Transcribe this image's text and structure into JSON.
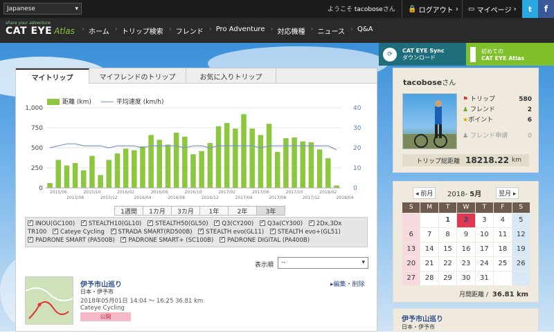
{
  "topbar": {
    "language": "Japanese",
    "welcome_prefix": "ようこそ",
    "username": "tacobose",
    "welcome_suffix": "さん",
    "logout": "ログアウト",
    "mypage": "マイページ",
    "twitter": "t",
    "facebook": "f"
  },
  "nav": {
    "tagline": "share your adventure",
    "brand": "CAT EYE",
    "brand_accent": "Atlas",
    "items": [
      "ホーム",
      "トリップ検索",
      "フレンド",
      "Pro Adventure",
      "対応機種",
      "ニュース",
      "Q&A"
    ]
  },
  "banners": {
    "sync_line1": "CAT EYE Sync",
    "sync_line2": "ダウンロード",
    "first_line1": "初めての",
    "first_line2": "CAT EYE Atlas"
  },
  "tabs": [
    "マイトリップ",
    "マイフレンドのトリップ",
    "お気に入りトリップ"
  ],
  "chart_data": {
    "type": "bar",
    "legend": [
      "距離 (km)",
      "平均速度 (km/h)"
    ],
    "series": [
      {
        "name": "距離 (km)",
        "values": [
          60,
          350,
          280,
          310,
          220,
          400,
          160,
          350,
          430,
          490,
          470,
          520,
          660,
          600,
          540,
          690,
          640,
          420,
          460,
          560,
          770,
          810,
          740,
          920,
          740,
          660,
          800,
          450,
          620,
          630,
          580,
          570,
          480,
          370,
          30
        ]
      },
      {
        "name": "平均速度 (km/h)",
        "values": [
          20,
          21,
          22,
          22,
          21,
          21,
          21,
          20,
          21,
          21,
          21,
          20,
          21,
          21,
          21,
          21,
          20,
          21,
          21,
          20,
          21,
          21,
          21,
          21,
          21,
          20,
          21,
          21,
          21,
          21,
          21,
          21,
          21,
          21,
          19
        ]
      }
    ],
    "y_left": {
      "min": 0,
      "max": 1000,
      "ticks": [
        "0",
        "250",
        "500",
        "750",
        "1,000"
      ]
    },
    "y_right": {
      "min": 0,
      "max": 40,
      "ticks": [
        "0",
        "10",
        "20",
        "30",
        "40"
      ]
    },
    "x_ticks_upper": [
      "2015/06",
      "2015/10",
      "2016/02",
      "2016/06",
      "2016/10",
      "2017/02",
      "2017/06",
      "2017/10",
      "2018/02"
    ],
    "x_ticks_lower": [
      "2015/08",
      "2015/12",
      "2016/04",
      "2016/08",
      "2016/12",
      "2017/04",
      "2017/08",
      "2017/12",
      "2018/04"
    ]
  },
  "ranges": [
    "1週間",
    "1カ月",
    "3カ月",
    "1年",
    "2年",
    "3年"
  ],
  "devices": [
    "INOU(GC100)",
    "STEALTH10(GL10)",
    "STEALTH50(GL50)",
    "Q3(CY200)",
    "Q3a(CY300)",
    "2Dx,3Dx",
    "TR100",
    "Cateye Cycling",
    "STRADA SMART(RD500B)",
    "STEALTH evo(GL11)",
    "STEALTH evo+(GL51)",
    "PADRONE SMART (PA500B)",
    "PADRONE SMART+ (SC100B)",
    "PADRONE DIGITAL (PA400B)"
  ],
  "sort": {
    "label": "表示順",
    "value": "--"
  },
  "trip": {
    "title": "伊予市山巡り",
    "edit": "▸編集・削除",
    "location": "日本・伊予市",
    "datetime": "2018年05月01日 14:04 〜 16:25   36.81 km",
    "device": "Cateye Cycling",
    "status": "公開"
  },
  "profile": {
    "name": "tacobose",
    "name_suffix": "さん",
    "trips_label": "トリップ",
    "trips": "580",
    "friends_label": "フレンド",
    "friends": "2",
    "points_label": "ポイント",
    "points": "6",
    "requests_label": "フレンド申請",
    "requests": "0",
    "total_label": "トリップ総距離",
    "total": "18218.22",
    "total_unit": "km"
  },
  "calendar": {
    "prev": "◂ 前月",
    "next": "翌月 ▸",
    "year": "2018-",
    "month": "5月",
    "dow": [
      "S",
      "M",
      "T",
      "W",
      "T",
      "F",
      "S"
    ],
    "days": [
      "",
      "",
      "1",
      "2",
      "3",
      "4",
      "5",
      "6",
      "7",
      "8",
      "9",
      "10",
      "11",
      "12",
      "13",
      "14",
      "15",
      "16",
      "17",
      "18",
      "19",
      "20",
      "21",
      "22",
      "23",
      "24",
      "25",
      "26",
      "27",
      "28",
      "29",
      "30",
      "31",
      "",
      ""
    ],
    "monthly_label": "月間距離 /",
    "monthly": "36.81 km"
  },
  "mini_trip": {
    "title": "伊予市山巡り",
    "location": "日本・伊予市"
  }
}
